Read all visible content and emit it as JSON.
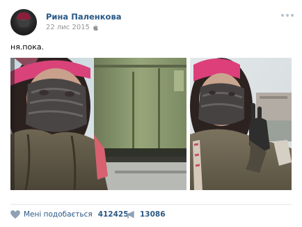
{
  "post": {
    "author": "Рина Паленкова",
    "date": "22 лис 2015",
    "text": "ня.пока.",
    "likes_label": "Мені подобається",
    "likes_count": "412425",
    "shares_count": "13086"
  },
  "icons": {
    "avatar": "avatar",
    "platform": "apple-icon",
    "more": "more-dots-icon",
    "like": "heart-icon",
    "share": "megaphone-icon"
  },
  "colors": {
    "link": "#2a5885",
    "muted": "#939393",
    "icon": "#b9c3cd",
    "divider": "#e7e8ec"
  },
  "photos": [
    {
      "name": "photo-selfie-train"
    },
    {
      "name": "photo-selfie-peace-sign"
    }
  ]
}
